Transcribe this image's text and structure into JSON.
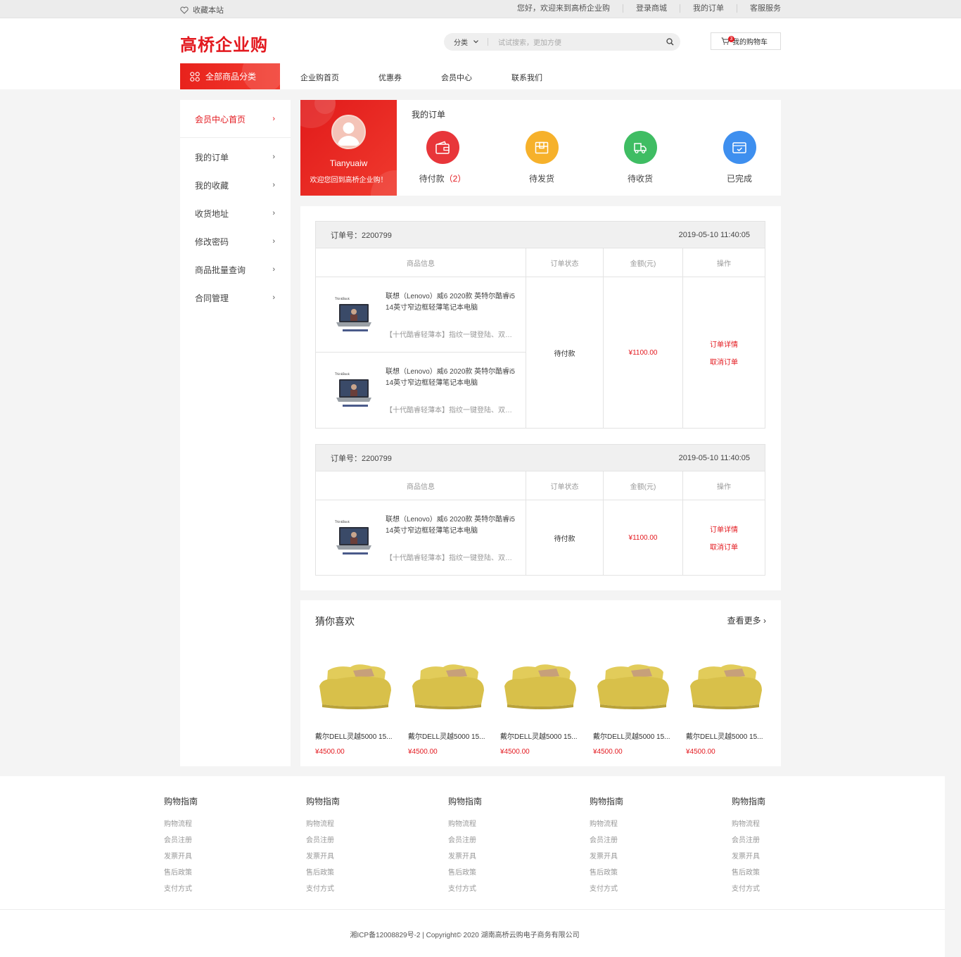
{
  "topbar": {
    "favorite": "收藏本站",
    "links": [
      "您好，欢迎来到高桥企业购",
      "登录商城",
      "我的订单",
      "客服服务"
    ]
  },
  "header": {
    "logo": "高桥企业购",
    "search_category": "分类",
    "search_placeholder": "试试搜索，更加方便",
    "cart_label": "我的购物车",
    "cart_count": "3",
    "all_categories": "全部商品分类",
    "nav": [
      "企业购首页",
      "优惠券",
      "会员中心",
      "联系我们"
    ]
  },
  "sidebar": {
    "items": [
      "会员中心首页",
      "我的订单",
      "我的收藏",
      "收货地址",
      "修改密码",
      "商品批量查询",
      "合同管理"
    ]
  },
  "profile": {
    "username": "Tianyuaiw",
    "welcome": "欢迎您回到高桥企业购！"
  },
  "my_orders": {
    "title": "我的订单",
    "statuses": [
      {
        "label": "待付款",
        "count": "（2）",
        "color": "#e8363a"
      },
      {
        "label": "待发货",
        "count": "",
        "color": "#f6b12b"
      },
      {
        "label": "待收货",
        "count": "",
        "color": "#3fbd63"
      },
      {
        "label": "已完成",
        "count": "",
        "color": "#3e8fef"
      }
    ]
  },
  "order_columns": [
    "商品信息",
    "订单状态",
    "金额(元)",
    "操作"
  ],
  "orders": [
    {
      "order_no": "订单号：2200799",
      "time": "2019-05-10 11:40:05",
      "status": "待付款",
      "amount": "¥1100.00",
      "actions": [
        "订单详情",
        "取消订单"
      ],
      "products": [
        {
          "name": "联想（Lenovo）威6 2020款 英特尔酷睿i5 14英寸窄边框轻薄笔记本电脑",
          "desc": "【十代酷睿轻薄本】指纹一键登陆、双天..."
        },
        {
          "name": "联想（Lenovo）威6 2020款 英特尔酷睿i5 14英寸窄边框轻薄笔记本电脑",
          "desc": "【十代酷睿轻薄本】指纹一键登陆、双天..."
        }
      ]
    },
    {
      "order_no": "订单号：2200799",
      "time": "2019-05-10 11:40:05",
      "status": "待付款",
      "amount": "¥1100.00",
      "actions": [
        "订单详情",
        "取消订单"
      ],
      "products": [
        {
          "name": "联想（Lenovo）威6 2020款 英特尔酷睿i5 14英寸窄边框轻薄笔记本电脑",
          "desc": "【十代酷睿轻薄本】指纹一键登陆、双天..."
        }
      ]
    }
  ],
  "guess": {
    "title": "猜你喜欢",
    "more": "查看更多",
    "items": [
      {
        "name": "戴尔DELL灵越5000 15...",
        "price": "¥4500.00"
      },
      {
        "name": "戴尔DELL灵越5000 15...",
        "price": "¥4500.00"
      },
      {
        "name": "戴尔DELL灵越5000 15...",
        "price": "¥4500.00"
      },
      {
        "name": "戴尔DELL灵越5000 15...",
        "price": "¥4500.00"
      },
      {
        "name": "戴尔DELL灵越5000 15...",
        "price": "¥4500.00"
      }
    ]
  },
  "footer": {
    "columns": [
      {
        "title": "购物指南",
        "links": [
          "购物流程",
          "会员注册",
          "发票开具",
          "售后政策",
          "支付方式"
        ]
      },
      {
        "title": "购物指南",
        "links": [
          "购物流程",
          "会员注册",
          "发票开具",
          "售后政策",
          "支付方式"
        ]
      },
      {
        "title": "购物指南",
        "links": [
          "购物流程",
          "会员注册",
          "发票开具",
          "售后政策",
          "支付方式"
        ]
      },
      {
        "title": "购物指南",
        "links": [
          "购物流程",
          "会员注册",
          "发票开具",
          "售后政策",
          "支付方式"
        ]
      },
      {
        "title": "购物指南",
        "links": [
          "购物流程",
          "会员注册",
          "发票开具",
          "售后政策",
          "支付方式"
        ]
      }
    ],
    "copyright": "湘ICP备12008829号-2 | Copyright©  2020 湖南高桥云购电子商务有限公司"
  },
  "colors": {
    "accent": "#e3191f"
  }
}
